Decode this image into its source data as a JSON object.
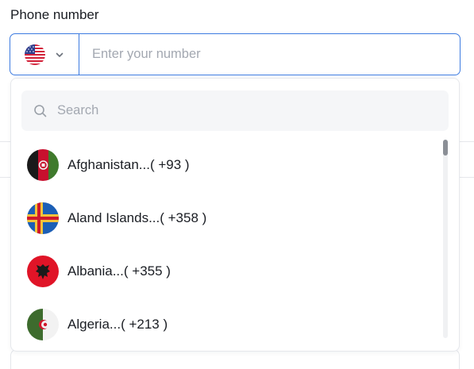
{
  "field": {
    "label": "Phone number",
    "placeholder": "Enter your number",
    "selected_country_flag": "us-flag-icon"
  },
  "dropdown": {
    "search_placeholder": "Search",
    "items": [
      {
        "label": "Afghanistan...( +93 )",
        "flag": "afghanistan-flag-icon"
      },
      {
        "label": "Aland Islands...( +358 )",
        "flag": "aland-islands-flag-icon"
      },
      {
        "label": "Albania...( +355 )",
        "flag": "albania-flag-icon"
      },
      {
        "label": "Algeria...( +213 )",
        "flag": "algeria-flag-icon"
      }
    ]
  },
  "colors": {
    "accent": "#3d7be0",
    "placeholder": "#a3a8b1",
    "search_bg": "#f5f6f8"
  }
}
